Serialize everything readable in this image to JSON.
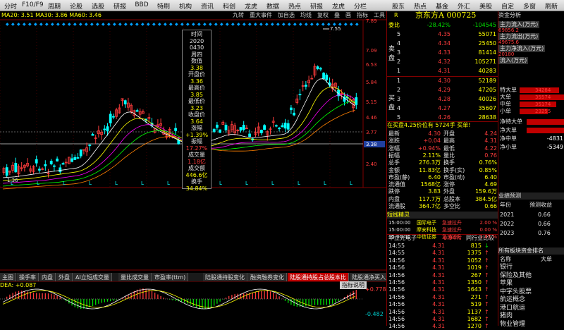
{
  "toolbar": {
    "left_items": [
      "分时",
      "F10/F9",
      "周期",
      "论股",
      "选股",
      "研报",
      "BBD",
      "特刷",
      "机构",
      "资讯",
      "科创",
      "龙虎",
      "数据",
      "热点",
      "研报",
      "龙虎",
      "分栏"
    ],
    "right_items": [
      "股东",
      "热点",
      "基金",
      "外汇",
      "美股",
      "自定",
      "多窗",
      "刷新"
    ]
  },
  "chart": {
    "ma_text": "MA20: 3.51  MA30: 3.86  MA60: 3.46",
    "top_icons": [
      "九转",
      "重大事件",
      "加自选",
      "均线",
      "复权",
      "叠",
      "画",
      "指标",
      "工具"
    ],
    "price_labels": [
      "7.89",
      "7.09",
      "6.53",
      "5.84",
      "5.15",
      "4.46",
      "3.77",
      "3.38",
      "2.40"
    ],
    "high_annot": "7.55",
    "low_annot": "1.36",
    "popup": [
      "时间",
      "2020",
      "0430",
      "周四",
      "数值",
      "3.38",
      "开盘价",
      "3.36",
      "最高价",
      "3.85",
      "最低价",
      "3.23",
      "收盘价",
      "3.64",
      "涨幅",
      "+1.39%",
      "振幅",
      "17.27%",
      "成交量",
      "1.18亿",
      "成交额",
      "446.6亿",
      "换手",
      "34.84%"
    ],
    "tabs": [
      "主图",
      "操手率",
      "内盘",
      "外盘",
      "AI立短成交量",
      "量比成交量",
      "市盈率(ttm)",
      "陆股通持股变化",
      "融资融券变化",
      "陆股通持股占总股本比",
      "陆股通净买入量",
      "..."
    ],
    "active_tab": 9,
    "macd_label": "DEA: +0.087",
    "macd_button": "指标说明",
    "macd_top": "+0.778",
    "macd_bot": "-0.482"
  },
  "quote": {
    "code_label": "R",
    "name": "京东方A 000725",
    "wei_bi": {
      "label": "委比",
      "pct": "-28.42%",
      "diff": "-104545"
    },
    "sell_label": "卖盘",
    "buy_label": "买盘",
    "asks": [
      {
        "n": "5",
        "p": "4.35",
        "v": "55071"
      },
      {
        "n": "4",
        "p": "4.34",
        "v": "25450"
      },
      {
        "n": "3",
        "p": "4.33",
        "v": "81414"
      },
      {
        "n": "2",
        "p": "4.32",
        "v": "105271"
      },
      {
        "n": "1",
        "p": "4.31",
        "v": "40283"
      }
    ],
    "bids": [
      {
        "n": "1",
        "p": "4.30",
        "v": "52189"
      },
      {
        "n": "2",
        "p": "4.29",
        "v": "47205"
      },
      {
        "n": "3",
        "p": "4.28",
        "v": "40026"
      },
      {
        "n": "4",
        "p": "4.27",
        "v": "35607"
      },
      {
        "n": "5",
        "p": "4.26",
        "v": "28638"
      }
    ],
    "order_line": "在买盘4.25价位有 5724手 买单!",
    "stats": [
      [
        "最新",
        "4.30",
        "开盘",
        "4.24"
      ],
      [
        "涨跌",
        "+0.04",
        "最高",
        "4.31"
      ],
      [
        "涨幅",
        "+0.94%",
        "最低",
        "4.22"
      ],
      [
        "振幅",
        "2.11%",
        "量比",
        "0.76"
      ],
      [
        "总手",
        "276.3万",
        "换手",
        "0.76%"
      ],
      [
        "金额",
        "11.83亿",
        "换手(实)",
        "0.85%"
      ],
      [
        "市盈(静)",
        "6.40",
        "市盈(动)",
        "6.40"
      ],
      [
        "流通值",
        "1568亿",
        "涨停",
        "4.69"
      ],
      [
        "跌停",
        "3.83",
        "外盘",
        "159.6万"
      ],
      [
        "内盘",
        "117.7万",
        "总股本",
        "384.5亿"
      ],
      [
        "流通股",
        "364.7亿",
        "多空比",
        "0.66"
      ]
    ],
    "news_title": "短线精灵",
    "news": [
      [
        "15:00:00",
        "国际电子",
        "急速拉升",
        "2.00 %"
      ],
      [
        "15:00:00",
        "摩安科技",
        "急速拉升",
        "0.00 %"
      ],
      [
        "15:00:00",
        "中信证券",
        "急速拉升",
        "1.85 %"
      ]
    ],
    "news2_title": "华立光电子",
    "news2_pct": "0.94%",
    "news2_tab": "同行业比较",
    "ticks": [
      [
        "14:55",
        "4.31",
        "815",
        "s"
      ],
      [
        "14:55",
        "4.31",
        "1375",
        "b"
      ],
      [
        "14:56",
        "4.31",
        "1052",
        "b"
      ],
      [
        "14:56",
        "4.31",
        "1019",
        "b"
      ],
      [
        "14:56",
        "4.31",
        "267",
        "b"
      ],
      [
        "14:56",
        "4.31",
        "1350",
        "b"
      ],
      [
        "14:56",
        "4.31",
        "1643",
        "b"
      ],
      [
        "14:56",
        "4.31",
        "271",
        "b"
      ],
      [
        "14:56",
        "4.31",
        "519",
        "b"
      ],
      [
        "14:56",
        "4.31",
        "1137",
        "b"
      ],
      [
        "14:56",
        "4.31",
        "1682",
        "b"
      ],
      [
        "14:56",
        "4.31",
        "1270",
        "b"
      ]
    ]
  },
  "fund": {
    "title": "资金分析",
    "items": [
      {
        "label": "主力流入(万元)",
        "value": "69856.2"
      },
      {
        "label": "主力流出(万元)",
        "value": "49675.6"
      },
      {
        "label": "主力净流入(万元)",
        "value": "20180"
      },
      {
        "label": "流入(万元)",
        "value": ""
      }
    ],
    "bars": [
      {
        "label": "特大单",
        "value": "34284"
      },
      {
        "label": "大单",
        "value": "35574"
      },
      {
        "label": "中单",
        "value": "35174"
      },
      {
        "label": "小单",
        "value": "23255"
      }
    ],
    "net": [
      {
        "label": "净特大单",
        "value": ""
      },
      {
        "label": "净大单",
        "value": ""
      },
      {
        "label": "净中单",
        "value": "-4831"
      },
      {
        "label": "净小单",
        "value": "-5349"
      }
    ],
    "forecast_title": "业绩预测",
    "forecast_head": [
      "年份",
      "预测收益"
    ],
    "forecast": [
      [
        "2021",
        "0.66"
      ],
      [
        "2022",
        "0.66"
      ],
      [
        "2023",
        "0.76"
      ]
    ],
    "sector_title": "所有板块资金排名",
    "sector_head": [
      "名称",
      "大单"
    ],
    "sectors": [
      "银行",
      "保险及其他",
      "苹果",
      "中字头股票",
      "航运概念",
      "港口航运",
      "猪肉",
      "物业管理"
    ]
  },
  "colors": {
    "up": "#ff3c3c",
    "down": "#00ffff",
    "accent": "#ffff00"
  }
}
